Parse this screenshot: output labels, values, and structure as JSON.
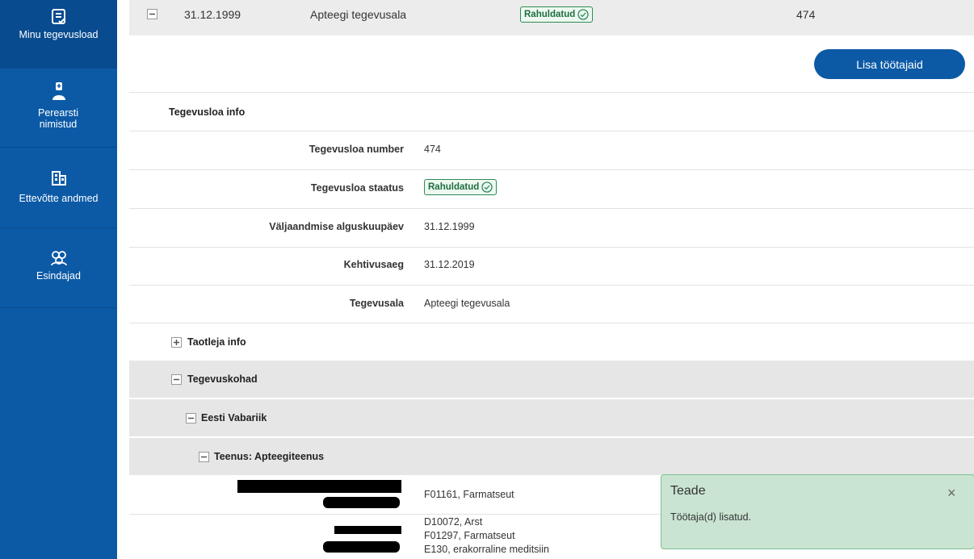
{
  "sidebar": {
    "items": [
      {
        "label": "Minu tegevusload",
        "icon": "license-icon"
      },
      {
        "label": "Perearsti nimistud",
        "icon": "doctor-icon"
      },
      {
        "label": "Ettevõtte andmed",
        "icon": "building-icon"
      },
      {
        "label": "Esindajad",
        "icon": "people-icon"
      }
    ]
  },
  "license_row": {
    "date": "31.12.1999",
    "area": "Apteegi tegevusala",
    "status": "Rahuldatud",
    "number": "474"
  },
  "actions": {
    "add_employees": "Lisa töötajaid"
  },
  "license_info": {
    "title": "Tegevusloa info",
    "fields": [
      {
        "label": "Tegevusloa number",
        "value": "474"
      },
      {
        "label": "Tegevusloa staatus",
        "value": "Rahuldatud"
      },
      {
        "label": "Väljaandmise alguskuupäev",
        "value": "31.12.1999"
      },
      {
        "label": "Kehtivusaeg",
        "value": "31.12.2019"
      },
      {
        "label": "Tegevusala",
        "value": "Apteegi tegevusala"
      }
    ]
  },
  "tree": {
    "applicant": "Taotleja info",
    "locations": "Tegevuskohad",
    "country": "Eesti Vabariik",
    "service": "Teenus: Apteegiteenus"
  },
  "employees": [
    {
      "lines": [
        "F01161, Farmatseut"
      ]
    },
    {
      "lines": [
        "D10072, Arst",
        "F01297, Farmatseut",
        "E130, erakorraline meditsiin"
      ]
    }
  ],
  "toast": {
    "title": "Teade",
    "message": "Töötaja(d) lisatud.",
    "close": "×"
  },
  "colors": {
    "primary": "#0c5aa6",
    "success_border": "#2c8a55",
    "toast_bg": "#c9e4d1",
    "grey_row": "#e6e6e6"
  }
}
